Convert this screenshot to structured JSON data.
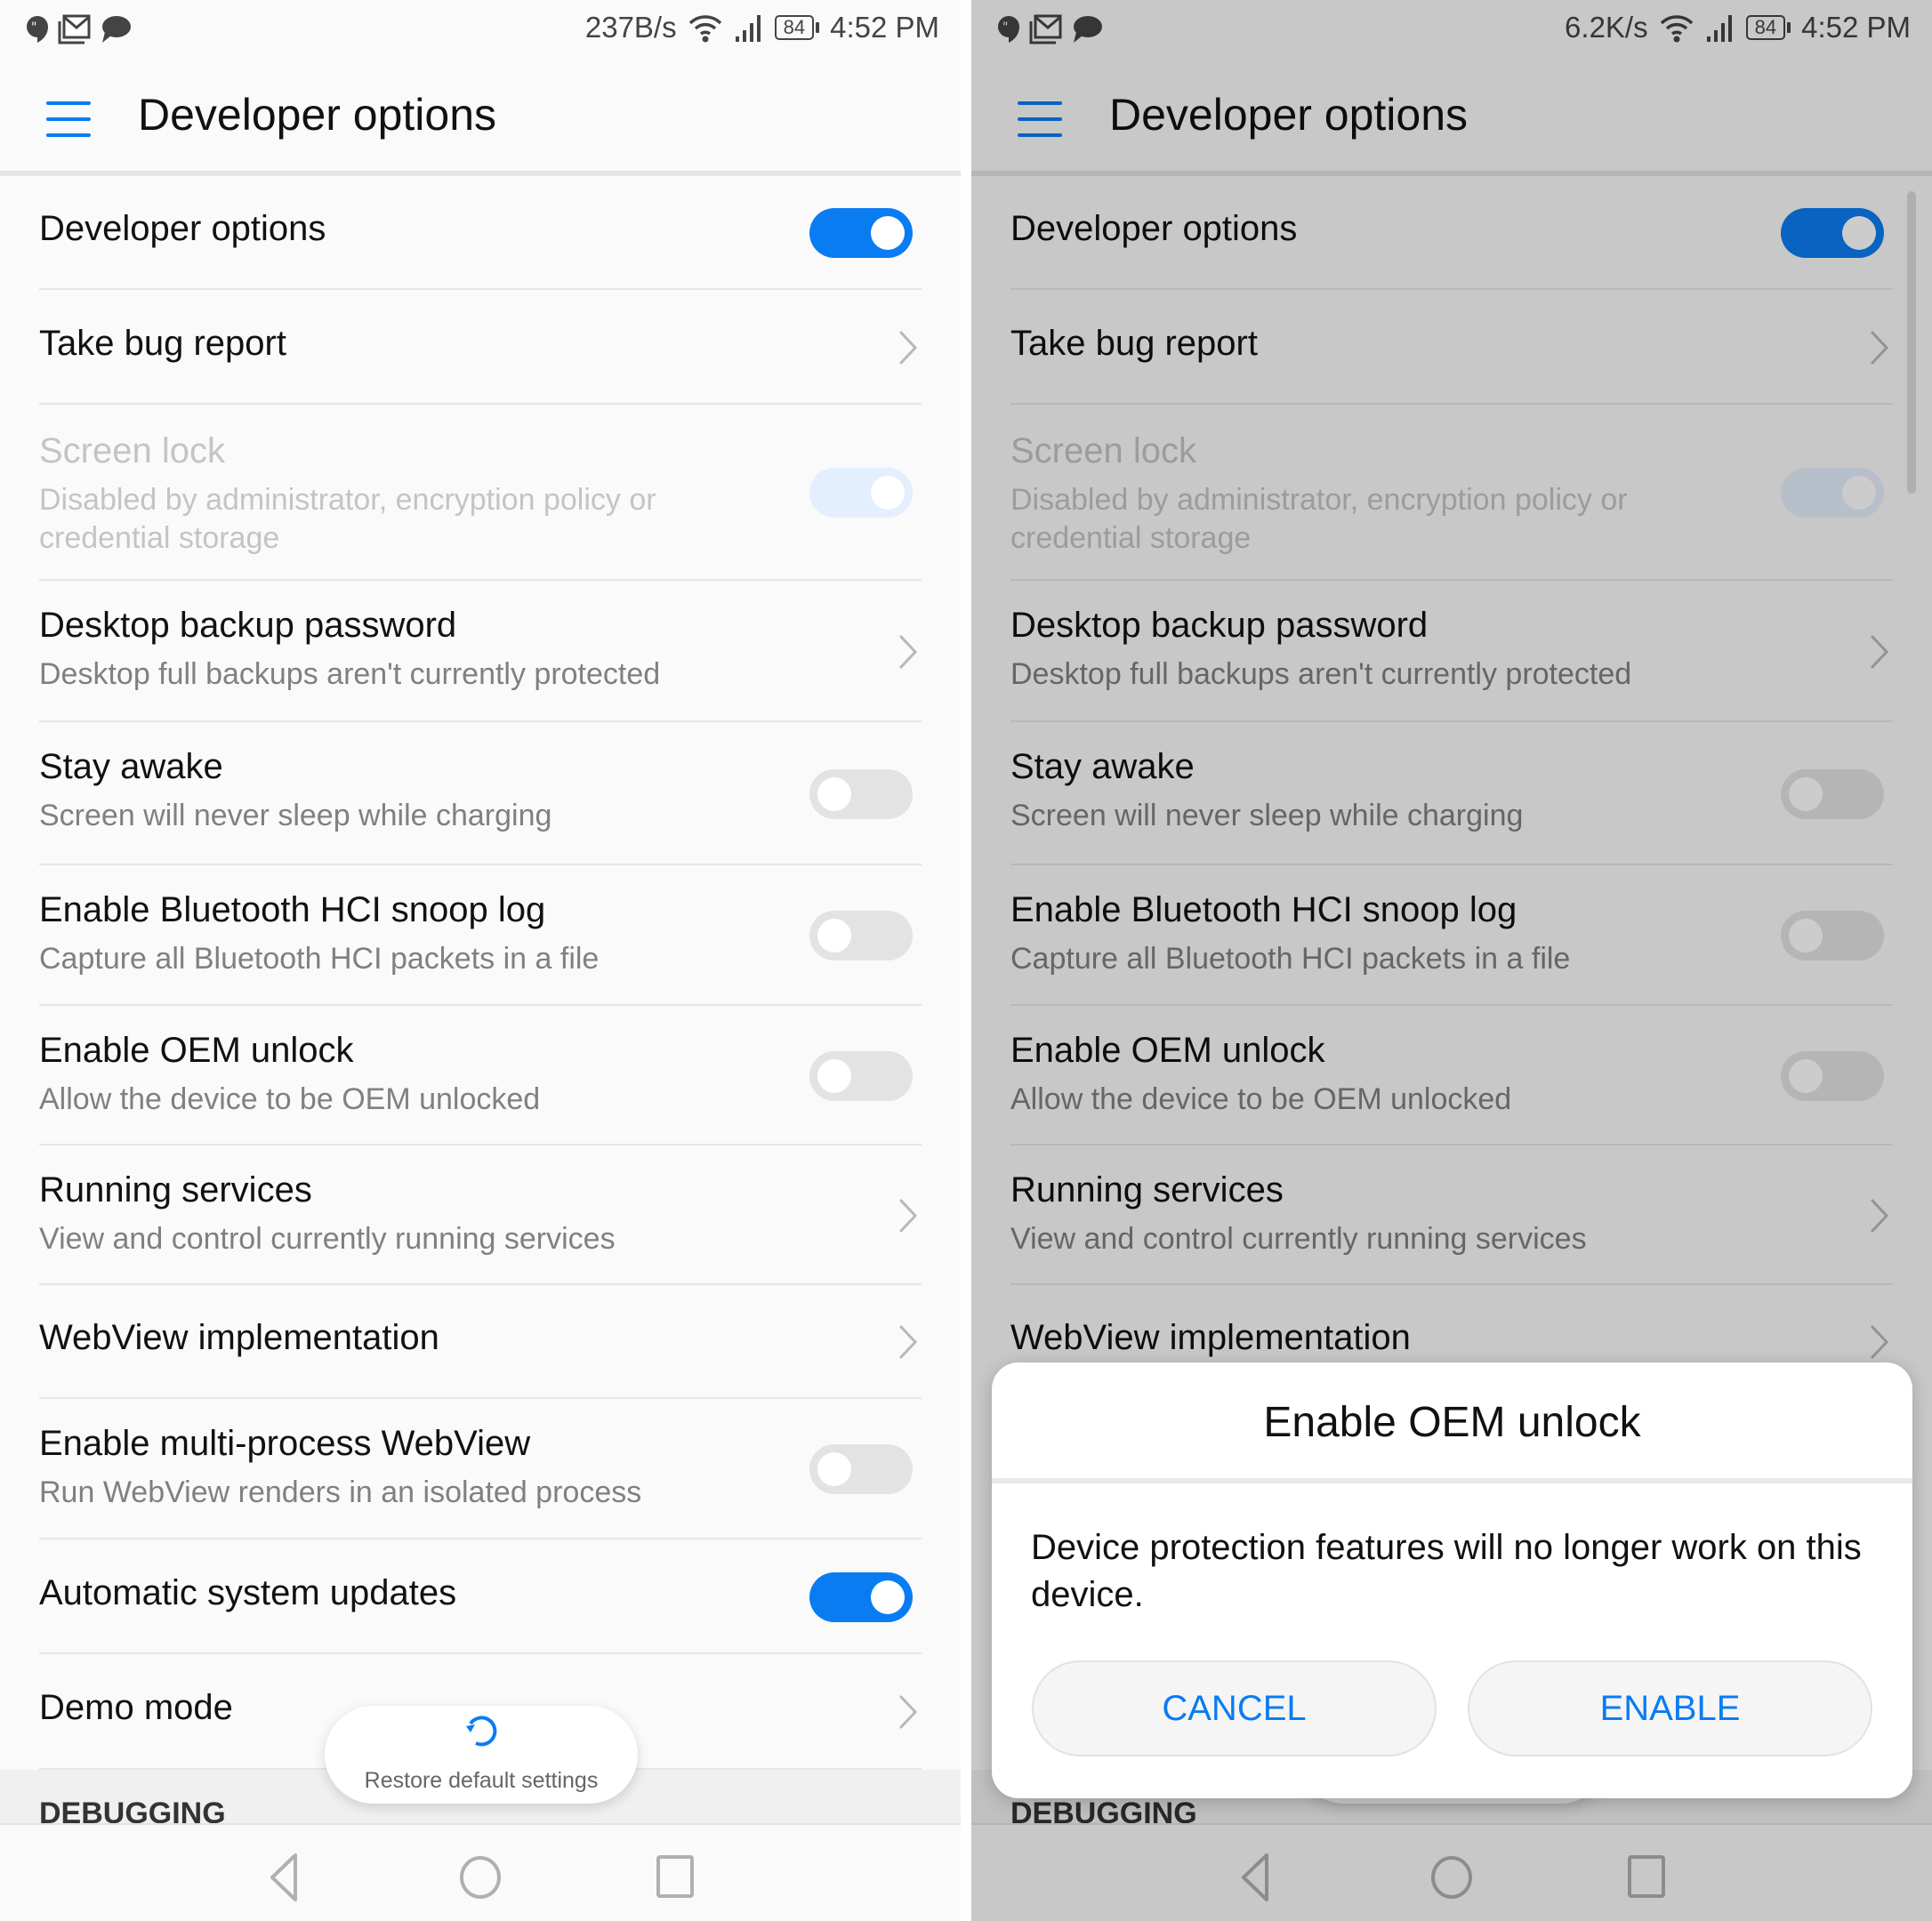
{
  "panels": {
    "left": {
      "status_bar": {
        "notification_icons": [
          "hangouts-icon",
          "gmail-icon",
          "messages-icon"
        ],
        "network_speed": "237B/s",
        "battery": "84",
        "time": "4:52 PM"
      }
    },
    "right": {
      "status_bar": {
        "notification_icons": [
          "hangouts-icon",
          "gmail-icon",
          "messages-icon"
        ],
        "network_speed": "6.2K/s",
        "battery": "84",
        "time": "4:52 PM"
      }
    }
  },
  "header": {
    "title": "Developer options",
    "menu_icon": "hamburger-menu-icon"
  },
  "settings": [
    {
      "title": "Developer options",
      "subtitle": null,
      "control": "toggle",
      "state": "on",
      "disabled": false
    },
    {
      "title": "Take bug report",
      "subtitle": null,
      "control": "chevron",
      "disabled": false
    },
    {
      "title": "Screen lock",
      "subtitle": "Disabled by administrator, encryption policy or",
      "subtitle2": "credential storage",
      "control": "toggle",
      "state": "on",
      "disabled": true
    },
    {
      "title": "Desktop backup password",
      "subtitle": "Desktop full backups aren't currently protected",
      "control": "chevron",
      "disabled": false
    },
    {
      "title": "Stay awake",
      "subtitle": "Screen will never sleep while charging",
      "control": "toggle",
      "state": "off",
      "disabled": false
    },
    {
      "title": "Enable Bluetooth HCI snoop log",
      "subtitle": "Capture all Bluetooth HCI packets in a file",
      "control": "toggle",
      "state": "off",
      "disabled": false
    },
    {
      "title": "Enable OEM unlock",
      "subtitle": "Allow the device to be OEM unlocked",
      "control": "toggle",
      "state": "off",
      "disabled": false
    },
    {
      "title": "Running services",
      "subtitle": "View and control currently running services",
      "control": "chevron",
      "disabled": false
    },
    {
      "title": "WebView implementation",
      "subtitle": null,
      "control": "chevron",
      "disabled": false
    },
    {
      "title": "Enable multi-process WebView",
      "subtitle": "Run WebView renders in an isolated process",
      "control": "toggle",
      "state": "off",
      "disabled": false
    },
    {
      "title": "Automatic system updates",
      "subtitle": null,
      "control": "toggle",
      "state": "on",
      "disabled": false
    },
    {
      "title": "Demo mode",
      "subtitle": null,
      "control": "chevron",
      "disabled": false
    }
  ],
  "section": {
    "label": "DEBUGGING"
  },
  "restore": {
    "label": "Restore default settings",
    "icon": "restore-icon"
  },
  "navbar": {
    "buttons": [
      "back-icon",
      "home-icon",
      "recents-icon"
    ]
  },
  "dialog": {
    "title": "Enable OEM unlock",
    "message": "Device protection features will no longer work on this device.",
    "cancel_label": "CANCEL",
    "enable_label": "ENABLE"
  },
  "colors": {
    "accent": "#0a7cf2",
    "toggle_off": "#e3e3e3",
    "background": "#fafafa"
  }
}
